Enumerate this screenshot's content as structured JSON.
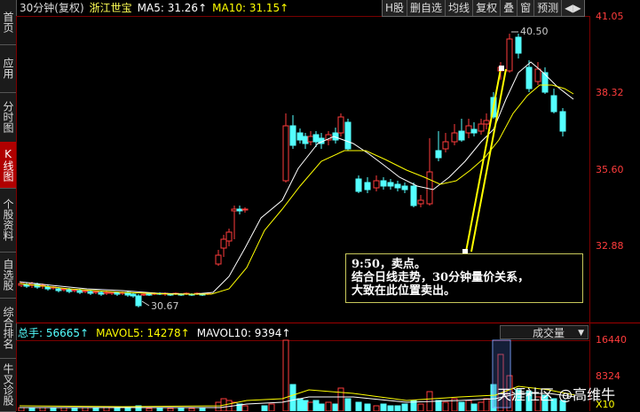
{
  "sidebar": {
    "tabs": [
      {
        "label": "首页"
      },
      {
        "label": "应用",
        "prefix": "▸"
      },
      {
        "label": "分时图"
      },
      {
        "label": "K线图",
        "active": true
      },
      {
        "label": "个股资料"
      },
      {
        "label": "自选股"
      },
      {
        "label": "综合排名"
      },
      {
        "label": "牛叉诊股"
      }
    ]
  },
  "header": {
    "period": "30分钟(复权)",
    "stock_name": "浙江世宝",
    "ma5_label": "MA5: 31.26↑",
    "ma10_label": "MA10: 31.15↑"
  },
  "toolbar": {
    "items": [
      "H股",
      "删自选",
      "均线",
      "复权",
      "叠",
      "窗",
      "预测",
      "◀▶"
    ]
  },
  "price_axis": {
    "labels": [
      "41.05",
      "38.32",
      "35.60",
      "32.88"
    ]
  },
  "annotations": {
    "high_marker": "40.50",
    "low_marker": "30.67",
    "note_lines": [
      "9:50，卖点。",
      "结合日线走势，30分钟量价关系，",
      "大致在此位置卖出。"
    ]
  },
  "volume_panel": {
    "total_label": "总手: 56665↑",
    "mavol5_label": "MAVOL5: 14278↑",
    "mavol10_label": "MAVOL10: 9394↑",
    "selector_value": "成交量",
    "axis_labels": [
      "16440",
      "8324",
      "X10"
    ]
  },
  "watermark": "天涯社区 @高维牛",
  "colors": {
    "up": "#ff3c3c",
    "down": "#54ffff",
    "ma5": "#ffffff",
    "ma10": "#ffff00",
    "annotation_line": "#ffff00"
  }
}
